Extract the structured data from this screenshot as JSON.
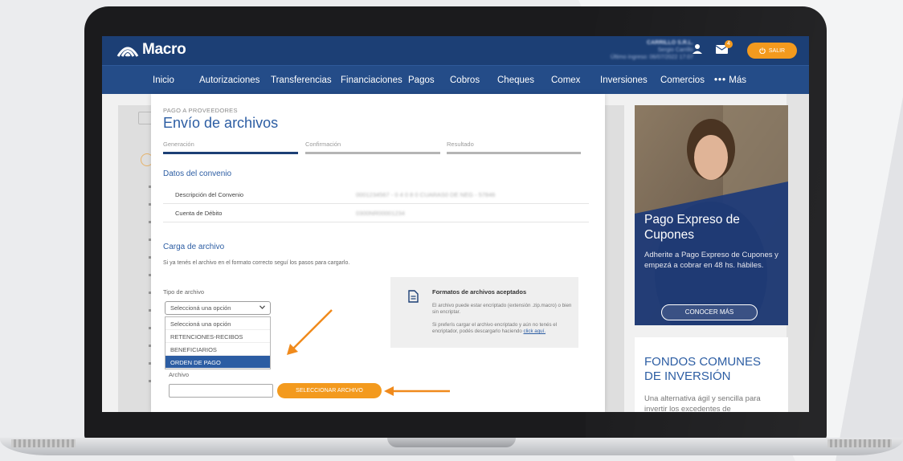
{
  "header": {
    "brand": "Macro",
    "user_name": "CARRILLO S.R.L.",
    "user_sub": "Sergio Carrillo",
    "user_last": "Último ingreso: 06/07/2022 17:07",
    "mail_count": "4",
    "logout_label": "SALIR"
  },
  "nav": {
    "items": [
      "Inicio",
      "Autorizaciones",
      "Transferencias",
      "Financiaciones",
      "Pagos",
      "Cobros",
      "Cheques",
      "Comex",
      "Inversiones",
      "Comercios"
    ],
    "more_label": "Más"
  },
  "form": {
    "eyebrow": "PAGO A PROVEEDORES",
    "title": "Envío de archivos",
    "steps": [
      "Generación",
      "Confirmación",
      "Resultado"
    ],
    "convenio_title": "Datos del convenio",
    "rows": [
      {
        "label": "Descripción del Convenio",
        "value": "0001234567 - 0 4 0 8 0 CUARAS0 DE NEG - 57846"
      },
      {
        "label": "Cuenta de Débito",
        "value": "0300NR00001234"
      }
    ],
    "carga_title": "Carga de archivo",
    "helper": "Si ya tenés el archivo en el formato correcto seguí los pasos para cargarlo.",
    "tipo_label": "Tipo de archivo",
    "select_value": "Seleccioná una opción",
    "options": [
      "Seleccioná una opción",
      "RETENCIONES-RECIBOS",
      "BENEFICIARIOS",
      "ORDEN DE PAGO"
    ],
    "selected_option": "ORDEN DE PAGO",
    "archivo_label": "Archivo",
    "select_file_button": "SELECCIONAR ARCHIVO"
  },
  "info": {
    "title": "Formatos de archivos aceptados",
    "p1": "El archivo puede estar encriptado (extensión .zip.macro) o bien sin encriptar.",
    "p2_text": "Si preferís cargar el archivo encriptado y aún no tenés el encriptador, podés descargarlo haciendo",
    "p2_link": "click aquí."
  },
  "promo": {
    "headline": "Pago Expreso de Cupones",
    "text": "Adherite a Pago Expreso de Cupones y empezá a cobrar en 48 hs. hábiles.",
    "button": "CONOCER MÁS"
  },
  "fondos": {
    "title": "FONDOS COMUNES DE INVERSIÓN",
    "text": "Una alternativa ágil y sencilla para invertir los excedentes de"
  },
  "colors": {
    "topbar": "#1c3f75",
    "nav": "#244c88",
    "accent": "#f39a1e",
    "link_blue": "#2c5da3"
  },
  "icons": [
    "macro-logo-icon",
    "user-icon",
    "mail-icon",
    "power-icon",
    "chevron-down-icon",
    "document-icon",
    "more-dots-icon",
    "arrow-pointer-icon"
  ]
}
